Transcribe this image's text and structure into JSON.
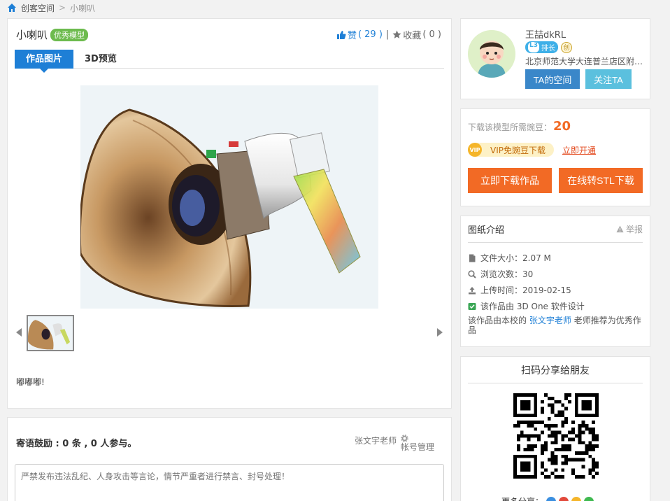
{
  "breadcrumb": {
    "home": "创客空间",
    "separator": ">",
    "current": "小喇叭"
  },
  "work": {
    "title": "小喇叭",
    "badge": "优秀模型",
    "like_label": "赞",
    "like_count": "( 29 )",
    "divider": "|",
    "fav_label": "收藏",
    "fav_count": "( 0 )",
    "description": "嘟嘟嘟!"
  },
  "tabs": [
    {
      "label": "作品图片",
      "active": true
    },
    {
      "label": "3D预览",
      "active": false
    }
  ],
  "comments": {
    "title": "寄语鼓励 : 0 条 , 0 人参与。",
    "user": "张文宇老师",
    "account": "帐号管理",
    "placeholder": "严禁发布违法乱纪、人身攻击等言论，情节严重者进行禁言、封号处理！"
  },
  "profile": {
    "name": "王喆dkRL",
    "level": "L3",
    "level_title": "排长",
    "badge": "创",
    "school": "北京师范大学大连普兰店区附属学校",
    "space_button": "TA的空间",
    "follow_button": "关注TA"
  },
  "download": {
    "cost_label": "下载该模型所需豌豆：",
    "cost": "20",
    "vip_icon": "VIP",
    "vip_label": "VIP免豌豆下载",
    "vip_open": "立即开通",
    "download_button": "立即下载作品",
    "stl_button": "在线转STL下载"
  },
  "info": {
    "title": "图纸介绍",
    "report": "举报",
    "items": [
      {
        "icon": "file-icon",
        "text": "文件大小：2.07 M"
      },
      {
        "icon": "views-icon",
        "text": "浏览次数：30"
      },
      {
        "icon": "upload-icon",
        "text": "上传时间：2019-02-15"
      },
      {
        "icon": "software-icon",
        "text": "该作品由 3D One 软件设计"
      }
    ],
    "note_prefix": "该作品由本校的",
    "note_teacher": "张文宇老师",
    "note_suffix": "老师推荐为优秀作品"
  },
  "share": {
    "title": "扫码分享给朋友",
    "more": "更多分享："
  },
  "colors": {
    "primary": "#1e7fd6",
    "orange": "#f26a25",
    "green": "#6dbb4e"
  }
}
